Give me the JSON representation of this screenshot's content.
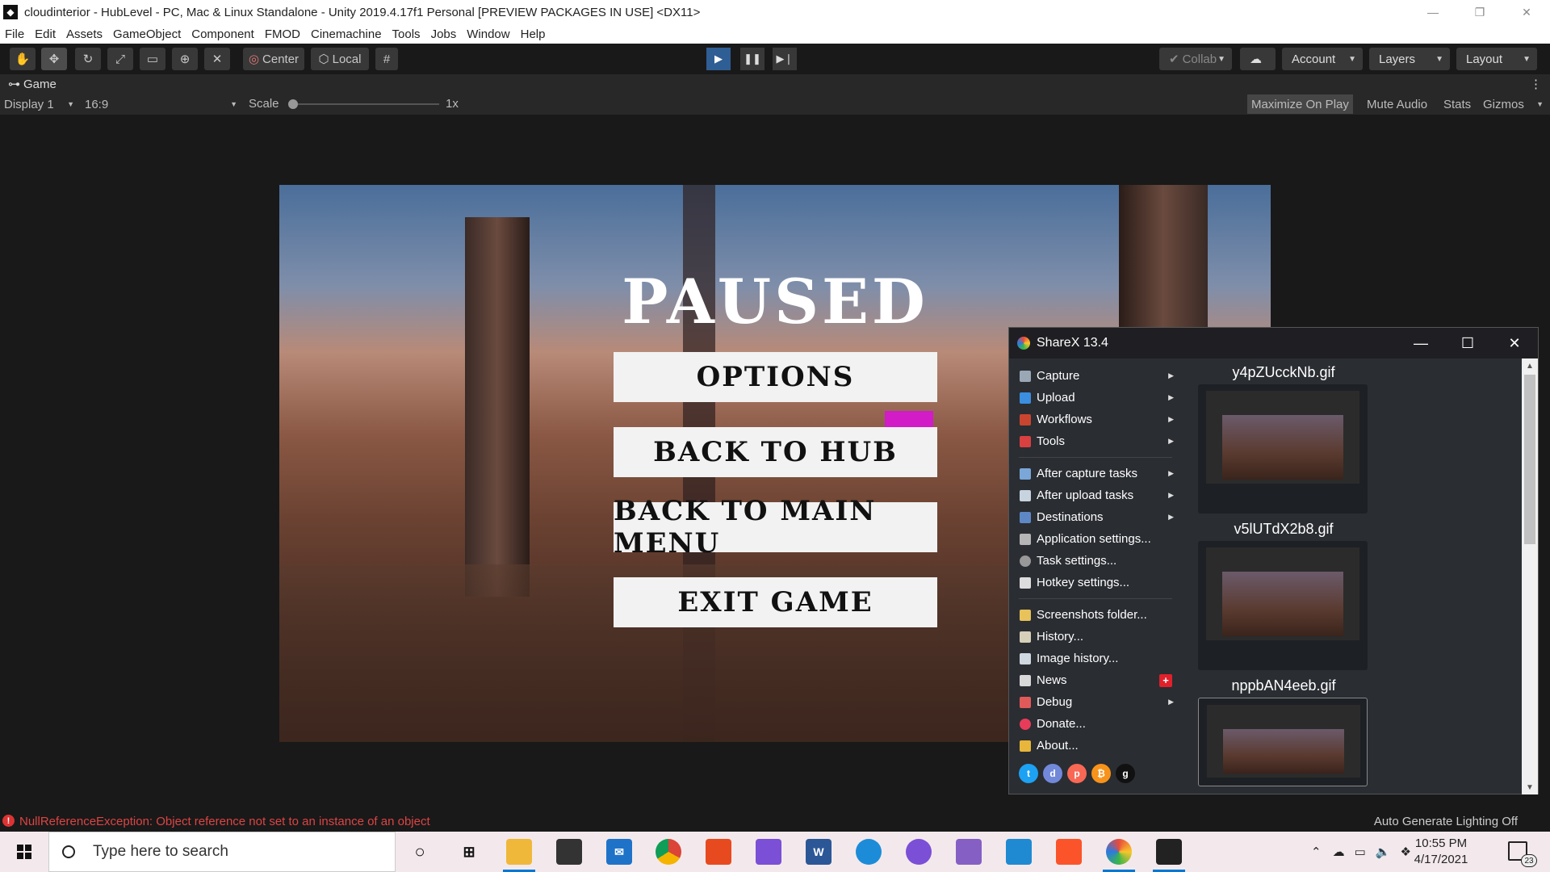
{
  "window": {
    "title": "cloudinterior - HubLevel - PC, Mac & Linux Standalone - Unity 2019.4.17f1 Personal [PREVIEW PACKAGES IN USE] <DX11>",
    "minimize": "—",
    "restore": "❐",
    "close": "✕"
  },
  "menu": [
    "File",
    "Edit",
    "Assets",
    "GameObject",
    "Component",
    "FMOD",
    "Cinemachine",
    "Tools",
    "Jobs",
    "Window",
    "Help"
  ],
  "toolbar": {
    "center": "Center",
    "local": "Local",
    "collab": "Collab",
    "account": "Account",
    "layers": "Layers",
    "layout": "Layout"
  },
  "game": {
    "tab": "Game",
    "display": "Display 1",
    "aspect": "16:9",
    "scale_label": "Scale",
    "scale_value": "1x",
    "maximize": "Maximize On Play",
    "mute": "Mute Audio",
    "stats": "Stats",
    "gizmos": "Gizmos"
  },
  "pause_menu": {
    "title": "PAUSED",
    "buttons": [
      "OPTIONS",
      "BACK TO HUB",
      "BACK TO MAIN MENU",
      "EXIT GAME"
    ]
  },
  "sharex": {
    "title": "ShareX 13.4",
    "menu_group1": [
      {
        "label": "Capture",
        "sub": true
      },
      {
        "label": "Upload",
        "sub": true
      },
      {
        "label": "Workflows",
        "sub": true
      },
      {
        "label": "Tools",
        "sub": true
      }
    ],
    "menu_group2": [
      {
        "label": "After capture tasks",
        "sub": true
      },
      {
        "label": "After upload tasks",
        "sub": true
      },
      {
        "label": "Destinations",
        "sub": true
      },
      {
        "label": "Application settings...",
        "sub": false
      },
      {
        "label": "Task settings...",
        "sub": false
      },
      {
        "label": "Hotkey settings...",
        "sub": false
      }
    ],
    "menu_group3": [
      {
        "label": "Screenshots folder...",
        "sub": false
      },
      {
        "label": "History...",
        "sub": false
      },
      {
        "label": "Image history...",
        "sub": false
      },
      {
        "label": "News",
        "sub": false
      },
      {
        "label": "Debug",
        "sub": true
      },
      {
        "label": "Donate...",
        "sub": false
      },
      {
        "label": "About...",
        "sub": false
      }
    ],
    "files": [
      "y4pZUcckNb.gif",
      "v5lUTdX2b8.gif",
      "nppbAN4eeb.gif"
    ]
  },
  "status": {
    "error": "NullReferenceException: Object reference not set to an instance of an object",
    "lighting": "Auto Generate Lighting Off"
  },
  "taskbar": {
    "search_placeholder": "Type here to search",
    "time": "10:55 PM",
    "date": "4/17/2021",
    "notifications": "23"
  },
  "colors": {
    "accent": "#2f5e94",
    "error": "#dd4444",
    "taskbar": "#f3e9ec"
  }
}
